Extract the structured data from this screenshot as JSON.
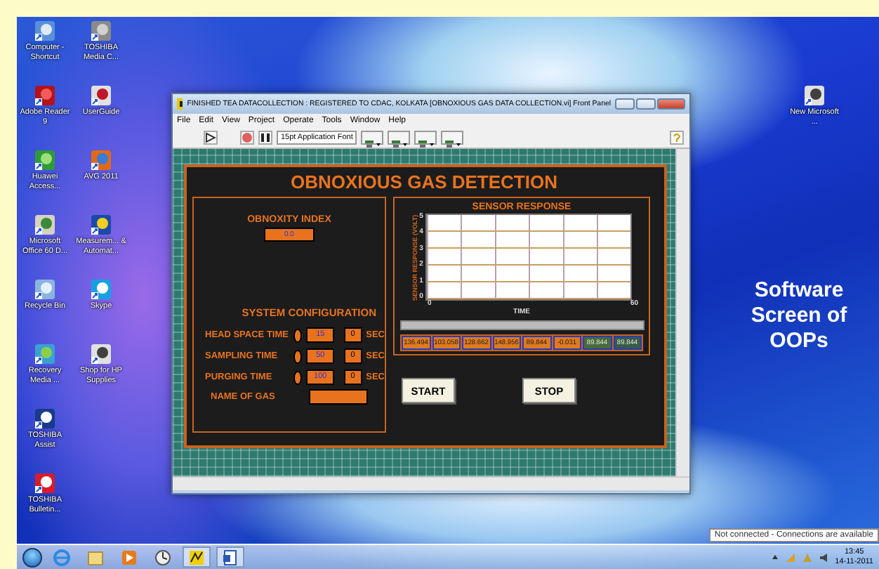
{
  "desktop_icons": [
    {
      "label": "Computer - Shortcut"
    },
    {
      "label": "Adobe Reader 9"
    },
    {
      "label": "Huawei Access..."
    },
    {
      "label": "Microsoft Office 60 D..."
    },
    {
      "label": "Recycle Bin"
    },
    {
      "label": "Recovery Media ..."
    },
    {
      "label": "TOSHIBA Assist"
    },
    {
      "label": "TOSHIBA Bulletin..."
    },
    {
      "label": "TOSHIBA Media C..."
    },
    {
      "label": "UserGuide"
    },
    {
      "label": "AVG 2011"
    },
    {
      "label": "Measurem... & Automat..."
    },
    {
      "label": "Skype"
    },
    {
      "label": "Shop for HP Supplies"
    }
  ],
  "desktop_file": {
    "label": "New Microsoft ..."
  },
  "caption": "Software Screen of OOPs",
  "window": {
    "title": "FINISHED TEA DATACOLLECTION : REGISTERED TO CDAC, KOLKATA [OBNOXIOUS GAS DATA COLLECTION.vi] Front Panel",
    "menu": [
      "File",
      "Edit",
      "View",
      "Project",
      "Operate",
      "Tools",
      "Window",
      "Help"
    ],
    "font_select": "15pt Application Font",
    "panel": {
      "title": "OBNOXIOUS GAS DETECTION",
      "index": {
        "label": "OBNOXITY INDEX",
        "value": "0.0"
      },
      "config_title": "SYSTEM CONFIGURATION",
      "settings": [
        {
          "label": "HEAD SPACE TIME",
          "value": "15",
          "seconds": "0",
          "unit": "SEC"
        },
        {
          "label": "SAMPLING TIME",
          "value": "50",
          "seconds": "0",
          "unit": "SEC"
        },
        {
          "label": "PURGING TIME",
          "value": "100",
          "seconds": "0",
          "unit": "SEC"
        }
      ],
      "gas_name": {
        "label": "NAME OF GAS"
      },
      "graph": {
        "title": "SENSOR RESPONSE",
        "ylabel": "SENSOR RESPONSE (VOLT)",
        "xlabel": "TIME",
        "yticks": [
          "5",
          "4",
          "3",
          "2",
          "1",
          "0"
        ],
        "xticks": [
          "0",
          "60"
        ]
      },
      "readouts": [
        {
          "value": "136.494",
          "color": "#e07a1e"
        },
        {
          "value": "103.058",
          "color": "#e07a1e"
        },
        {
          "value": "128.662",
          "color": "#e07a1e"
        },
        {
          "value": "148.956",
          "color": "#e07a1e"
        },
        {
          "value": "89.844",
          "color": "#e07a1e"
        },
        {
          "value": "-0.031",
          "color": "#e07a1e"
        },
        {
          "value": "89.844",
          "color": "#4a6a3a"
        },
        {
          "value": "89.844",
          "color": "#3a5a4a"
        }
      ],
      "buttons": [
        "START",
        "STOP"
      ]
    }
  },
  "taskbar": {
    "apps": [
      {
        "running": false
      },
      {
        "running": false
      },
      {
        "running": false
      },
      {
        "running": false
      },
      {
        "running": true
      },
      {
        "running": true
      }
    ],
    "tooltip": "Not connected - Connections are available",
    "time": "13:45",
    "date": "14-11-2011"
  }
}
